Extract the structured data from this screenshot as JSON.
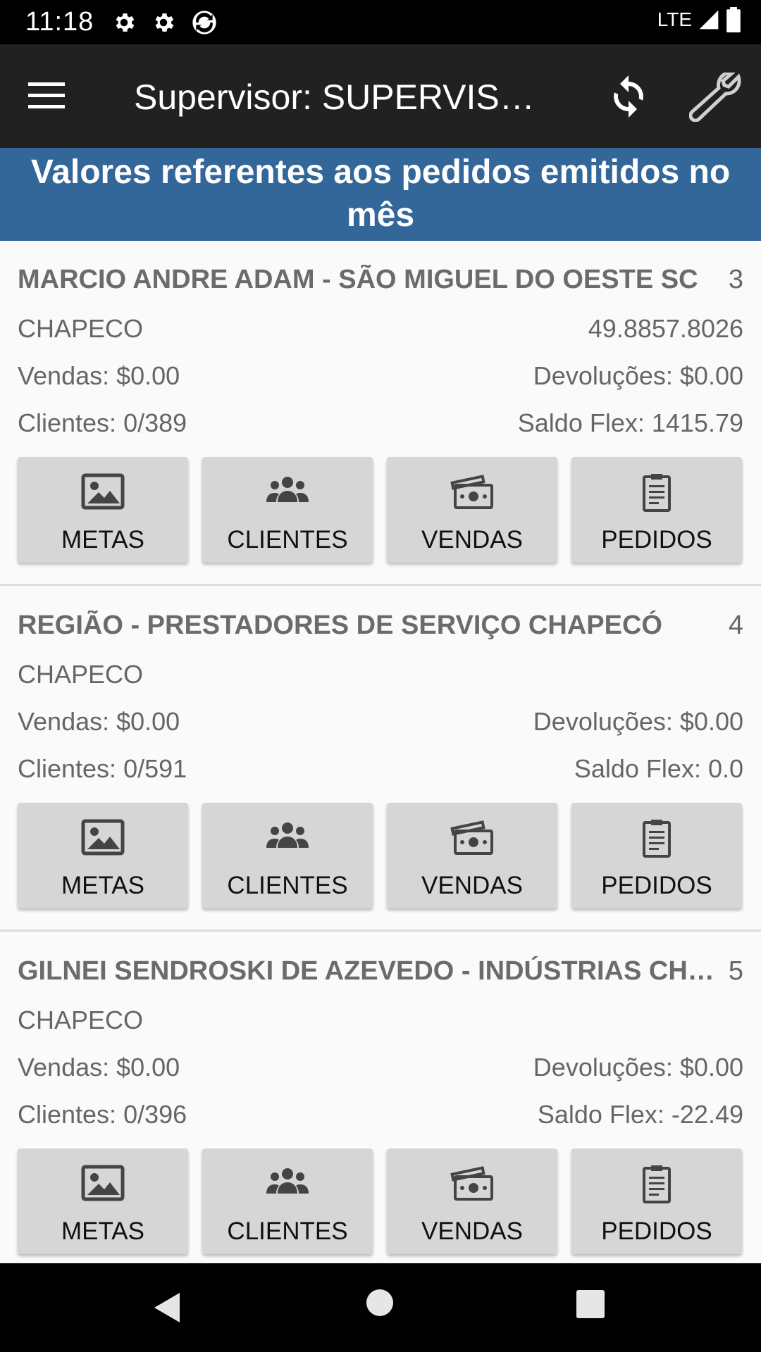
{
  "status_bar": {
    "time": "11:18",
    "network": "LTE"
  },
  "toolbar": {
    "title": "Supervisor: SUPERVISOR CHAPECO"
  },
  "banner": {
    "text": "Valores referentes aos pedidos emitidos no mês"
  },
  "buttons": {
    "metas": "METAS",
    "clientes": "CLIENTES",
    "vendas": "VENDAS",
    "pedidos": "PEDIDOS"
  },
  "cards": [
    {
      "name": "MARCIO ANDRE ADAM - SÃO MIGUEL DO OESTE SC",
      "number": "3",
      "city": "CHAPECO",
      "code": "49.8857.8026",
      "vendas": "Vendas: $0.00",
      "devolucoes": "Devoluções: $0.00",
      "clientes": "Clientes: 0/389",
      "saldo_flex": "Saldo Flex: 1415.79"
    },
    {
      "name": "REGIÃO - PRESTADORES DE SERVIÇO CHAPECÓ",
      "number": "4",
      "city": "CHAPECO",
      "code": "",
      "vendas": "Vendas: $0.00",
      "devolucoes": "Devoluções: $0.00",
      "clientes": "Clientes: 0/591",
      "saldo_flex": "Saldo Flex: 0.0"
    },
    {
      "name": "GILNEI SENDROSKI DE AZEVEDO - INDÚSTRIAS CHAPECÓ",
      "number": "5",
      "city": "CHAPECO",
      "code": "",
      "vendas": "Vendas: $0.00",
      "devolucoes": "Devoluções: $0.00",
      "clientes": "Clientes: 0/396",
      "saldo_flex": "Saldo Flex: -22.49"
    }
  ],
  "icons": {
    "metas": "image-icon",
    "clientes": "group-icon",
    "vendas": "money-icon",
    "pedidos": "clipboard-icon",
    "toolbar_left": "menu-icon",
    "toolbar_refresh": "refresh-icon",
    "toolbar_settings": "wrench-icon"
  }
}
